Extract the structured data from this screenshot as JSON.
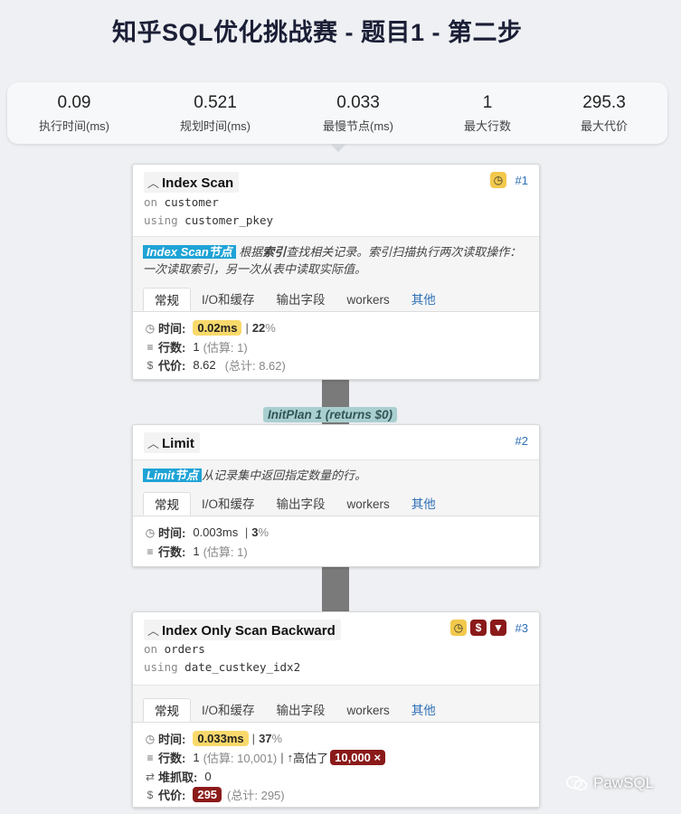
{
  "title": "知乎SQL优化挑战赛 - 题目1 - 第二步",
  "stats": [
    {
      "value": "0.09",
      "label": "执行时间(ms)"
    },
    {
      "value": "0.521",
      "label": "规划时间(ms)"
    },
    {
      "value": "0.033",
      "label": "最慢节点(ms)"
    },
    {
      "value": "1",
      "label": "最大行数"
    },
    {
      "value": "295.3",
      "label": "最大代价"
    }
  ],
  "tabs": [
    "常规",
    "I/O和缓存",
    "输出字段",
    "workers",
    "其他"
  ],
  "labels": {
    "time": "时间:",
    "rows": "行数:",
    "heap": "堆抓取:",
    "cost": "代价:"
  },
  "nodes": [
    {
      "title": "Index Scan",
      "id": "#1",
      "on_kw": "on",
      "on": "customer",
      "using_kw": "using",
      "using": "customer_pkey",
      "desc_highlight": "Index Scan节点",
      "desc_pre": "根据",
      "desc_bold": "索引",
      "desc_post": "查找相关记录。索引扫描执行两次读取操作：一次读取索引，另一次从表中读取实际值。",
      "time": "0.02ms",
      "time_pct": "22",
      "pct_sign": "%",
      "rows": "1",
      "rows_est": "(估算: 1)",
      "cost": "8.62",
      "cost_total": "(总计: 8.62)",
      "badges": [
        "clock-icon"
      ]
    },
    {
      "title": "Limit",
      "id": "#2",
      "desc_highlight": "Limit节点",
      "desc_post": "从记录集中返回指定数量的行。",
      "time": "0.003ms",
      "time_pct": "3",
      "pct_sign": "%",
      "rows": "1",
      "rows_est": "(估算: 1)"
    },
    {
      "title": "Index Only Scan Backward",
      "id": "#3",
      "on_kw": "on",
      "on": "orders",
      "using_kw": "using",
      "using": "date_custkey_idx2",
      "time": "0.033ms",
      "time_pct": "37",
      "pct_sign": "%",
      "rows": "1",
      "rows_est": "(估算: 10,001)",
      "overestimate_label": "高估了",
      "overestimate_value": "10,000 ×",
      "heap": "0",
      "cost": "295",
      "cost_total": "(总计: 295)",
      "badges": [
        "clock-icon",
        "dollar-icon",
        "thumbs-down-icon"
      ]
    }
  ],
  "initplan": "InitPlan 1 (returns $0)",
  "watermark": "PawSQL",
  "colors": {
    "highlight": "#1fa3d6",
    "pill_yellow": "#f9d96b",
    "pill_red": "#8b1a1a",
    "link": "#2e6fb5"
  }
}
